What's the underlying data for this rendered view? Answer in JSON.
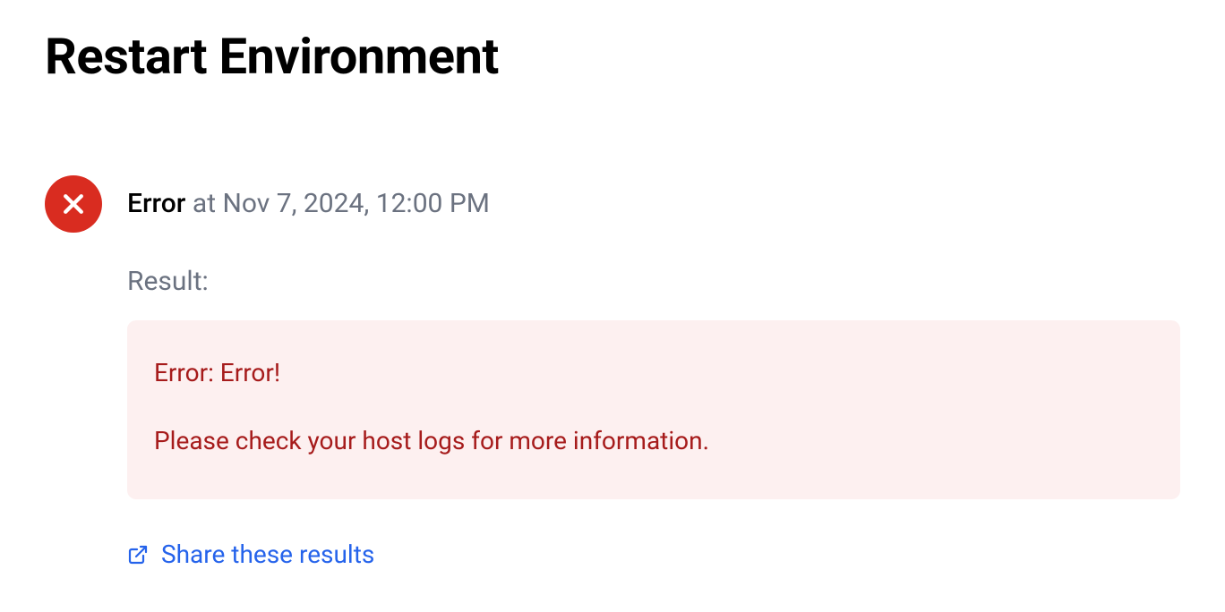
{
  "page": {
    "title": "Restart Environment"
  },
  "status": {
    "label": "Error",
    "timestamp_prefix": "at ",
    "timestamp": "Nov 7, 2024, 12:00 PM"
  },
  "result": {
    "label": "Result:",
    "line1": "Error:  Error!",
    "line2": "Please check your host logs for more information."
  },
  "share": {
    "label": "Share these results"
  }
}
